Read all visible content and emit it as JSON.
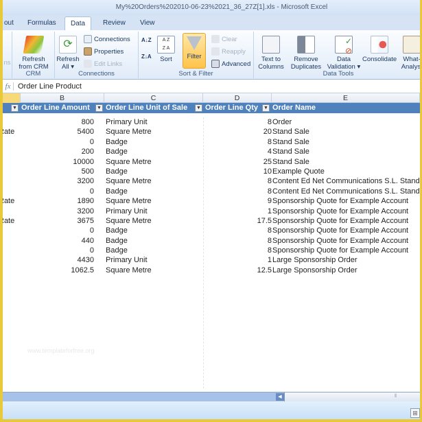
{
  "window": {
    "title": "My%20Orders%202010-06-23%2021_36_27Z[1].xls - Microsoft Excel"
  },
  "tabs": [
    {
      "label": "out",
      "active": false
    },
    {
      "label": "Formulas",
      "active": false
    },
    {
      "label": "Data",
      "active": true
    },
    {
      "label": "Review",
      "active": false
    },
    {
      "label": "View",
      "active": false
    }
  ],
  "ribbon": {
    "partial_group_label": "ns",
    "crm": {
      "refresh_line1": "Refresh",
      "refresh_line2": "from CRM",
      "label": "CRM"
    },
    "connections": {
      "refresh_all_line1": "Refresh",
      "refresh_all_line2": "All ▾",
      "connections": "Connections",
      "properties": "Properties",
      "edit_links": "Edit Links",
      "label": "Connections"
    },
    "sort_filter": {
      "sort_az": "A↓Z",
      "sort_za": "Z↓A",
      "sort": "Sort",
      "filter": "Filter",
      "clear": "Clear",
      "reapply": "Reapply",
      "advanced": "Advanced",
      "label": "Sort & Filter"
    },
    "data_tools": {
      "text_to_columns_1": "Text to",
      "text_to_columns_2": "Columns",
      "remove_duplicates_1": "Remove",
      "remove_duplicates_2": "Duplicates",
      "data_validation_1": "Data",
      "data_validation_2": "Validation ▾",
      "consolidate": "Consolidate",
      "whatif_1": "What-",
      "whatif_2": "Analysi",
      "label": "Data Tools"
    }
  },
  "formula_bar": {
    "fx": "fx",
    "value": "Order Line Product"
  },
  "columns": [
    "B",
    "C",
    "D",
    "E"
  ],
  "table": {
    "headers": [
      "Order Line Amount",
      "Order Line Unit of Sale",
      "Order Line Qty",
      "Order Name"
    ],
    "rows": [
      {
        "a": "",
        "amount": "800",
        "unit": "Primary Unit",
        "qty": "8",
        "name": "Order"
      },
      {
        "a": "Rate",
        "amount": "5400",
        "unit": "Square Metre",
        "qty": "20",
        "name": "Stand Sale"
      },
      {
        "a": "",
        "amount": "0",
        "unit": "Badge",
        "qty": "8",
        "name": "Stand Sale"
      },
      {
        "a": "",
        "amount": "200",
        "unit": "Badge",
        "qty": "4",
        "name": "Stand Sale"
      },
      {
        "a": "",
        "amount": "10000",
        "unit": "Square Metre",
        "qty": "25",
        "name": "Stand Sale"
      },
      {
        "a": "",
        "amount": "500",
        "unit": "Badge",
        "qty": "10",
        "name": "Example Quote"
      },
      {
        "a": "",
        "amount": "3200",
        "unit": "Square Metre",
        "qty": "8",
        "name": "Content Ed Net Communications S.L. Stand"
      },
      {
        "a": "",
        "amount": "0",
        "unit": "Badge",
        "qty": "8",
        "name": "Content Ed Net Communications S.L. Stand"
      },
      {
        "a": "Rate",
        "amount": "1890",
        "unit": "Square Metre",
        "qty": "9",
        "name": "Sponsorship Quote for Example Account"
      },
      {
        "a": "",
        "amount": "3200",
        "unit": "Primary Unit",
        "qty": "1",
        "name": "Sponsorship Quote for Example Account"
      },
      {
        "a": "Rate",
        "amount": "3675",
        "unit": "Square Metre",
        "qty": "17.5",
        "name": "Sponsorship Quote for Example Account"
      },
      {
        "a": "",
        "amount": "0",
        "unit": "Badge",
        "qty": "8",
        "name": "Sponsorship Quote for Example Account"
      },
      {
        "a": "",
        "amount": "440",
        "unit": "Badge",
        "qty": "8",
        "name": "Sponsorship Quote for Example Account"
      },
      {
        "a": "",
        "amount": "0",
        "unit": "Badge",
        "qty": "8",
        "name": "Sponsorship Quote for Example Account"
      },
      {
        "a": "",
        "amount": "4430",
        "unit": "Primary Unit",
        "qty": "1",
        "name": "Large Sponsorship Order"
      },
      {
        "a": "",
        "amount": "1062.5",
        "unit": "Square Metre",
        "qty": "12.5",
        "name": "Large Sponsorship Order"
      }
    ]
  },
  "watermark": "www.templateforfree.org",
  "colors": {
    "table_header": "#4f81bd",
    "filter_active": "#ffc34a",
    "frame": "#e8c93a"
  }
}
